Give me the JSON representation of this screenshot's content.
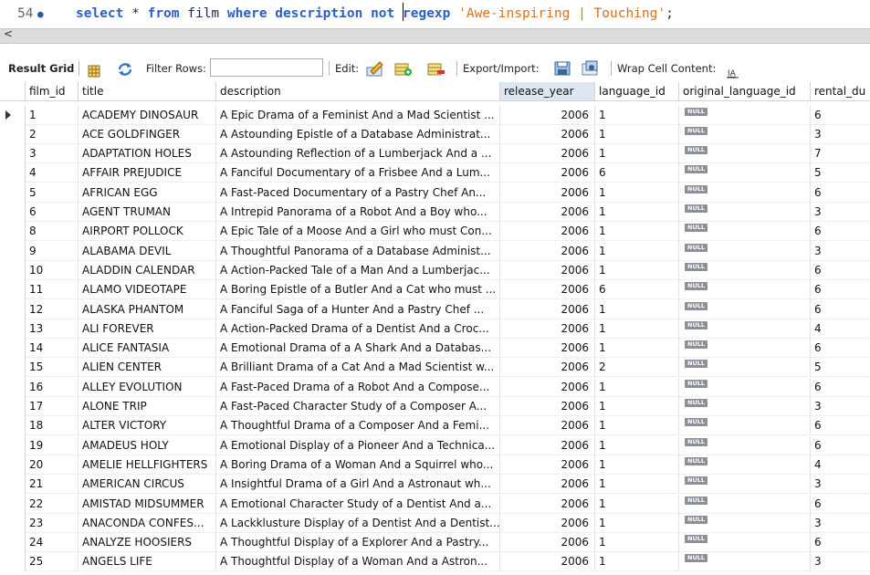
{
  "editor": {
    "line_number": "54",
    "marker": "●",
    "tokens": [
      {
        "t": "select",
        "c": "kw"
      },
      {
        "t": " ",
        "c": "id"
      },
      {
        "t": "*",
        "c": "id"
      },
      {
        "t": " ",
        "c": "id"
      },
      {
        "t": "from",
        "c": "kw"
      },
      {
        "t": " film ",
        "c": "id"
      },
      {
        "t": "where",
        "c": "kw"
      },
      {
        "t": " ",
        "c": "id"
      },
      {
        "t": "description",
        "c": "kw"
      },
      {
        "t": " ",
        "c": "id"
      },
      {
        "t": "not",
        "c": "kw"
      },
      {
        "t": " ",
        "c": "id"
      },
      {
        "t": "CARET",
        "c": "caret"
      },
      {
        "t": "regexp",
        "c": "kw"
      },
      {
        "t": " ",
        "c": "id"
      },
      {
        "t": "'Awe-inspiring | Touching'",
        "c": "str"
      },
      {
        "t": ";",
        "c": "id"
      }
    ]
  },
  "scrollbar": {
    "left_arrow": "<"
  },
  "toolbar": {
    "result_grid_label": "Result Grid",
    "filter_rows_label": "Filter Rows:",
    "filter_value": "",
    "edit_label": "Edit:",
    "export_import_label": "Export/Import:",
    "wrap_label": "Wrap Cell Content:"
  },
  "grid": {
    "columns": [
      "film_id",
      "title",
      "description",
      "release_year",
      "language_id",
      "original_language_id",
      "rental_du"
    ],
    "null_label": "NULL",
    "rows": [
      [
        "1",
        "ACADEMY DINOSAUR",
        "A Epic Drama of a Feminist And a Mad Scientist ...",
        "2006",
        "1",
        "NULL",
        "6"
      ],
      [
        "2",
        "ACE GOLDFINGER",
        "A Astounding Epistle of a Database Administrat...",
        "2006",
        "1",
        "NULL",
        "3"
      ],
      [
        "3",
        "ADAPTATION HOLES",
        "A Astounding Reflection of a Lumberjack And a ...",
        "2006",
        "1",
        "NULL",
        "7"
      ],
      [
        "4",
        "AFFAIR PREJUDICE",
        "A Fanciful Documentary of a Frisbee And a Lum...",
        "2006",
        "6",
        "NULL",
        "5"
      ],
      [
        "5",
        "AFRICAN EGG",
        "A Fast-Paced Documentary of a Pastry Chef An...",
        "2006",
        "1",
        "NULL",
        "6"
      ],
      [
        "6",
        "AGENT TRUMAN",
        "A Intrepid Panorama of a Robot And a Boy who...",
        "2006",
        "1",
        "NULL",
        "3"
      ],
      [
        "8",
        "AIRPORT POLLOCK",
        "A Epic Tale of a Moose And a Girl who must Con...",
        "2006",
        "1",
        "NULL",
        "6"
      ],
      [
        "9",
        "ALABAMA DEVIL",
        "A Thoughtful Panorama of a Database Administ...",
        "2006",
        "1",
        "NULL",
        "3"
      ],
      [
        "10",
        "ALADDIN CALENDAR",
        "A Action-Packed Tale of a Man And a Lumberjac...",
        "2006",
        "1",
        "NULL",
        "6"
      ],
      [
        "11",
        "ALAMO VIDEOTAPE",
        "A Boring Epistle of a Butler And a Cat who must ...",
        "2006",
        "6",
        "NULL",
        "6"
      ],
      [
        "12",
        "ALASKA PHANTOM",
        "A Fanciful Saga of a Hunter And a Pastry Chef ...",
        "2006",
        "1",
        "NULL",
        "6"
      ],
      [
        "13",
        "ALI FOREVER",
        "A Action-Packed Drama of a Dentist And a Croc...",
        "2006",
        "1",
        "NULL",
        "4"
      ],
      [
        "14",
        "ALICE FANTASIA",
        "A Emotional Drama of a A Shark And a Databas...",
        "2006",
        "1",
        "NULL",
        "6"
      ],
      [
        "15",
        "ALIEN CENTER",
        "A Brilliant Drama of a Cat And a Mad Scientist w...",
        "2006",
        "2",
        "NULL",
        "5"
      ],
      [
        "16",
        "ALLEY EVOLUTION",
        "A Fast-Paced Drama of a Robot And a Compose...",
        "2006",
        "1",
        "NULL",
        "6"
      ],
      [
        "17",
        "ALONE TRIP",
        "A Fast-Paced Character Study of a Composer A...",
        "2006",
        "1",
        "NULL",
        "3"
      ],
      [
        "18",
        "ALTER VICTORY",
        "A Thoughtful Drama of a Composer And a Femi...",
        "2006",
        "1",
        "NULL",
        "6"
      ],
      [
        "19",
        "AMADEUS HOLY",
        "A Emotional Display of a Pioneer And a Technica...",
        "2006",
        "1",
        "NULL",
        "6"
      ],
      [
        "20",
        "AMELIE HELLFIGHTERS",
        "A Boring Drama of a Woman And a Squirrel who...",
        "2006",
        "1",
        "NULL",
        "4"
      ],
      [
        "21",
        "AMERICAN CIRCUS",
        "A Insightful Drama of a Girl And a Astronaut wh...",
        "2006",
        "1",
        "NULL",
        "3"
      ],
      [
        "22",
        "AMISTAD MIDSUMMER",
        "A Emotional Character Study of a Dentist And a...",
        "2006",
        "1",
        "NULL",
        "6"
      ],
      [
        "23",
        "ANACONDA CONFES...",
        "A Lackklusture Display of a Dentist And a Dentist...",
        "2006",
        "1",
        "NULL",
        "3"
      ],
      [
        "24",
        "ANALYZE HOOSIERS",
        "A Thoughtful Display of a Explorer And a Pastry...",
        "2006",
        "1",
        "NULL",
        "6"
      ],
      [
        "25",
        "ANGELS LIFE",
        "A Thoughtful Display of a Woman And a Astron...",
        "2006",
        "1",
        "NULL",
        "3"
      ]
    ]
  },
  "colors": {
    "keyword": "#2b5ec6",
    "string": "#e06f1a",
    "sorted_header": "#dde6f1",
    "null_badge": "#8a8f98"
  }
}
